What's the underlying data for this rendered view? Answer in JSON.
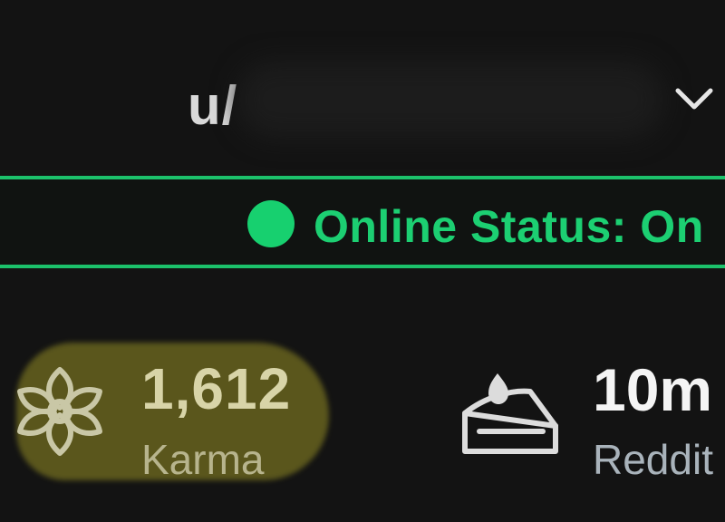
{
  "profile": {
    "username_prefix": "u/"
  },
  "status": {
    "text": "Online Status: On",
    "color": "#1cc26b"
  },
  "stats": {
    "karma_value": "1,612",
    "karma_label": "Karma",
    "karma_icon": "karma-flower-icon",
    "age_value": "10m",
    "age_label": "Reddit",
    "age_icon": "cake-icon"
  },
  "icons": {
    "dropdown": "chevron-down-icon"
  },
  "colors": {
    "background": "#131313",
    "highlight": "#5e5a1d",
    "status_green": "#1cc26b"
  }
}
